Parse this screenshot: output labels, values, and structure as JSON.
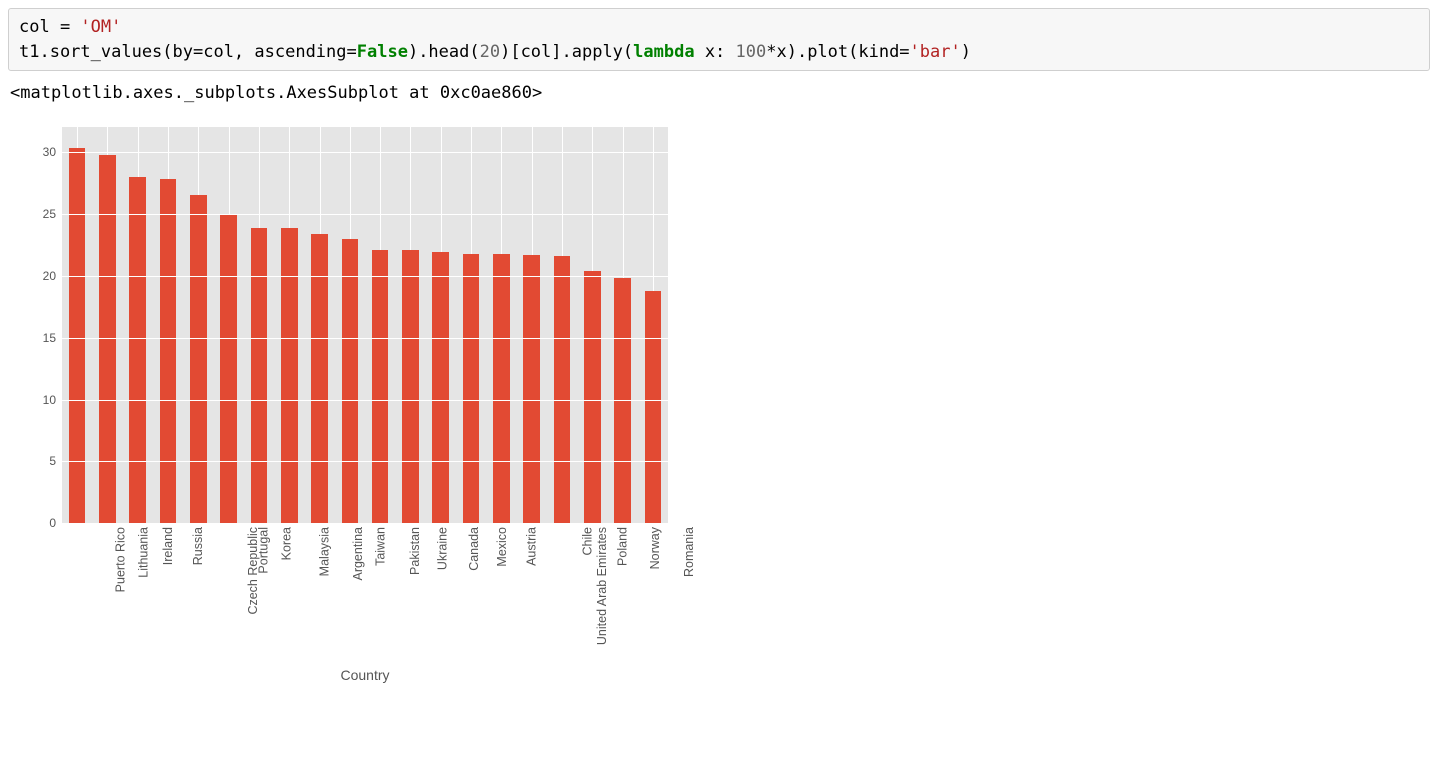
{
  "code": {
    "line1": {
      "v0": "col = ",
      "v1": "'OM'"
    },
    "line2": {
      "a": "t1.sort_values(by=col, ascending=",
      "b": "False",
      "c": ").head(",
      "d": "20",
      "e": ")[col].apply(",
      "f": "lambda",
      "g": " x: ",
      "h": "100",
      "i": "*x).plot(kind=",
      "j": "'bar'",
      "k": ")"
    }
  },
  "output_repr": "<matplotlib.axes._subplots.AxesSubplot at 0xc0ae860>",
  "chart_data": {
    "type": "bar",
    "title": "",
    "xlabel": "Country",
    "ylabel": "",
    "ylim": [
      0,
      32
    ],
    "yticks": [
      0,
      5,
      10,
      15,
      20,
      25,
      30
    ],
    "categories": [
      "Puerto Rico",
      "Lithuania",
      "Ireland",
      "Russia",
      "Czech Republic",
      "Portugal",
      "Korea",
      "Malaysia",
      "Argentina",
      "Taiwan",
      "Pakistan",
      "Ukraine",
      "Canada",
      "Mexico",
      "Austria",
      "United Arab Emirates",
      "Chile",
      "Poland",
      "Norway",
      "Romania"
    ],
    "values": [
      30.3,
      29.8,
      28.0,
      27.8,
      26.5,
      24.9,
      23.9,
      23.9,
      23.4,
      23.0,
      22.1,
      22.1,
      21.9,
      21.8,
      21.8,
      21.7,
      21.6,
      20.4,
      19.8,
      18.8
    ],
    "bar_color": "#e24a33"
  }
}
